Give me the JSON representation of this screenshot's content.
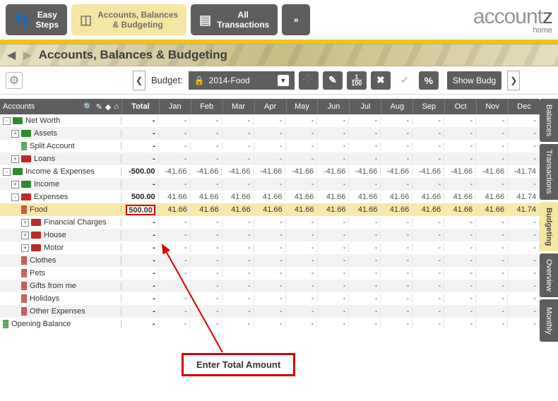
{
  "nav": {
    "easy_steps": "Easy\nSteps",
    "accounts": "Accounts, Balances\n& Budgeting",
    "all_tx": "All\nTransactions"
  },
  "logo": {
    "brand_light": "account",
    "brand_dark": "z",
    "sub": "home"
  },
  "crumbs": {
    "title": "Accounts, Balances & Budgeting"
  },
  "toolbar": {
    "budget_label": "Budget:",
    "budget_selected": "2014-Food",
    "show_budget": "Show Budg",
    "fraction_top": "1",
    "fraction_bottom": "100",
    "percent": "%"
  },
  "side_tabs": [
    "Balances",
    "Transactions",
    "Budgeting",
    "Overview",
    "Monthly"
  ],
  "active_side_tab": "Budgeting",
  "tree_head": {
    "label": "Accounts"
  },
  "months": [
    "Jan",
    "Feb",
    "Mar",
    "Apr",
    "May",
    "Jun",
    "Jul",
    "Aug",
    "Sep",
    "Oct",
    "Nov",
    "Dec"
  ],
  "total_label": "Total",
  "rows": [
    {
      "label": "Net Worth",
      "indent": 0,
      "toggle": "-",
      "icon": "folder-green"
    },
    {
      "label": "Assets",
      "indent": 1,
      "toggle": "+",
      "icon": "folder-green"
    },
    {
      "label": "Split Account",
      "indent": 2,
      "icon": "chart-green"
    },
    {
      "label": "Loans",
      "indent": 1,
      "toggle": "+",
      "icon": "folder-red"
    },
    {
      "label": "Income & Expenses",
      "indent": 0,
      "toggle": "-",
      "icon": "folder-green",
      "total": "-500.00",
      "month": "-41.66",
      "dec": "-41.74"
    },
    {
      "label": "Income",
      "indent": 1,
      "toggle": "+",
      "icon": "folder-green"
    },
    {
      "label": "Expenses",
      "indent": 1,
      "toggle": "-",
      "icon": "folder-red",
      "total": "500.00",
      "month": "41.66",
      "dec": "41.74"
    },
    {
      "label": "Food",
      "indent": 2,
      "icon": "chart-red",
      "total": "500.00",
      "month": "41.66",
      "dec": "41.74",
      "highlight": true,
      "boxed_total": true
    },
    {
      "label": "Financial Charges",
      "indent": 2,
      "toggle": "+",
      "icon": "folder-red"
    },
    {
      "label": "House",
      "indent": 2,
      "toggle": "+",
      "icon": "folder-red"
    },
    {
      "label": "Motor",
      "indent": 2,
      "toggle": "+",
      "icon": "folder-red"
    },
    {
      "label": "Clothes",
      "indent": 2,
      "icon": "chart-red"
    },
    {
      "label": "Pets",
      "indent": 2,
      "icon": "chart-red"
    },
    {
      "label": "Gifts from me",
      "indent": 2,
      "icon": "chart-red"
    },
    {
      "label": "Holidays",
      "indent": 2,
      "icon": "chart-red"
    },
    {
      "label": "Other Expenses",
      "indent": 2,
      "icon": "chart-red"
    },
    {
      "label": "Opening Balance",
      "indent": 0,
      "icon": "chart-green"
    }
  ],
  "callout": "Enter Total Amount"
}
